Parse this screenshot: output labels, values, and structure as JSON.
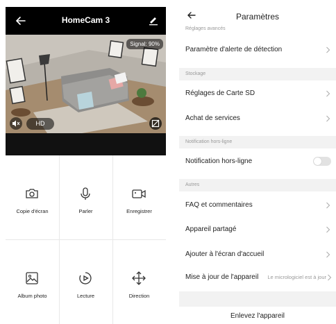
{
  "camera": {
    "title": "HomeCam 3",
    "signal": "Signal: 90%",
    "quality": "HD"
  },
  "actions": [
    {
      "label": "Copie d'écran",
      "icon": "camera-icon"
    },
    {
      "label": "Parler",
      "icon": "microphone-icon"
    },
    {
      "label": "Enregistrer",
      "icon": "video-record-icon"
    },
    {
      "label": "Album photo",
      "icon": "photo-album-icon"
    },
    {
      "label": "Lecture",
      "icon": "playback-icon"
    },
    {
      "label": "Direction",
      "icon": "direction-arrows-icon"
    }
  ],
  "settings": {
    "title": "Paramètres",
    "sections": {
      "advanced": "Réglages avancés",
      "storage": "Stockage",
      "offline": "Notification hors-ligne",
      "other": "Autres"
    },
    "items": {
      "detection_alert": "Paramètre d'alerte de détection",
      "sd_card": "Réglages de Carte SD",
      "services": "Achat de services",
      "offline_notification": "Notification hors-ligne",
      "faq": "FAQ et commentaires",
      "shared": "Appareil partagé",
      "home_screen": "Ajouter à l'écran d'accueil",
      "firmware": "Mise à jour de l'appareil",
      "firmware_status": "Le micrologiciel est à jour"
    },
    "offline_notification_enabled": false,
    "remove_device": "Enlevez l'appareil"
  }
}
